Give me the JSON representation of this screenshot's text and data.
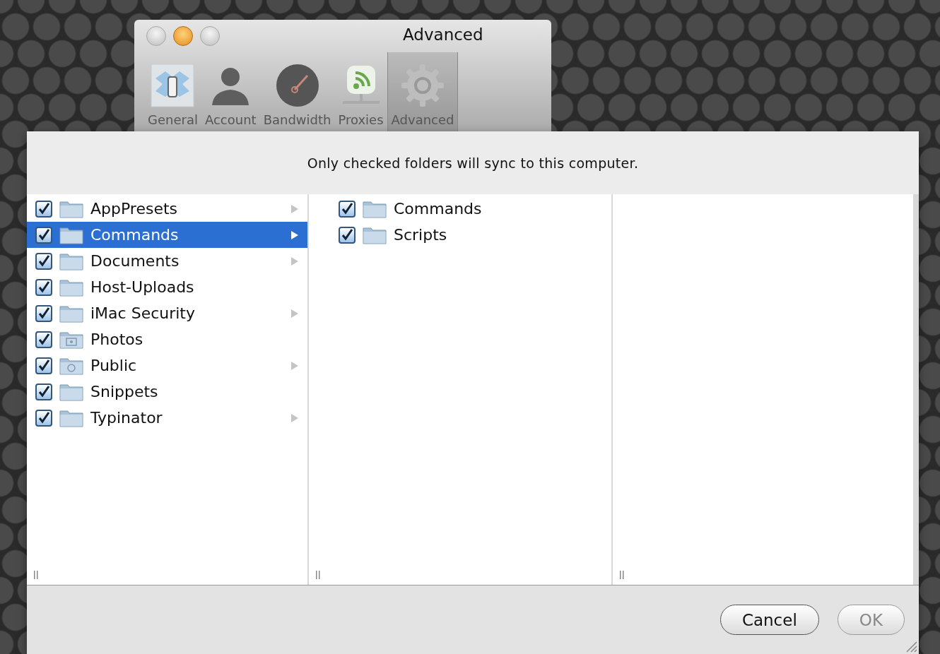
{
  "window": {
    "title": "Advanced"
  },
  "toolbar": [
    {
      "label": "General",
      "selected": false
    },
    {
      "label": "Account",
      "selected": false
    },
    {
      "label": "Bandwidth",
      "selected": false
    },
    {
      "label": "Proxies",
      "selected": false
    },
    {
      "label": "Advanced",
      "selected": true
    }
  ],
  "sheet": {
    "message": "Only checked folders will sync to this computer.",
    "columns": [
      {
        "items": [
          {
            "name": "AppPresets",
            "kind": "folder",
            "checked": true,
            "selected": false,
            "has_children": true
          },
          {
            "name": "Commands",
            "kind": "folder",
            "checked": true,
            "selected": true,
            "has_children": true
          },
          {
            "name": "Documents",
            "kind": "folder",
            "checked": true,
            "selected": false,
            "has_children": true
          },
          {
            "name": "Host-Uploads",
            "kind": "folder",
            "checked": true,
            "selected": false,
            "has_children": false
          },
          {
            "name": "iMac Security",
            "kind": "folder",
            "checked": true,
            "selected": false,
            "has_children": true
          },
          {
            "name": "Photos",
            "kind": "photos",
            "checked": true,
            "selected": false,
            "has_children": false
          },
          {
            "name": "Public",
            "kind": "public",
            "checked": true,
            "selected": false,
            "has_children": true
          },
          {
            "name": "Snippets",
            "kind": "folder",
            "checked": true,
            "selected": false,
            "has_children": false
          },
          {
            "name": "Typinator",
            "kind": "folder",
            "checked": true,
            "selected": false,
            "has_children": true
          }
        ]
      },
      {
        "items": [
          {
            "name": "Commands",
            "kind": "folder",
            "checked": true,
            "selected": false,
            "has_children": false
          },
          {
            "name": "Scripts",
            "kind": "folder",
            "checked": true,
            "selected": false,
            "has_children": false
          }
        ]
      },
      {}
    ],
    "buttons": [
      {
        "label": "Cancel",
        "disabled": false
      },
      {
        "label": "OK",
        "disabled": true
      }
    ]
  }
}
